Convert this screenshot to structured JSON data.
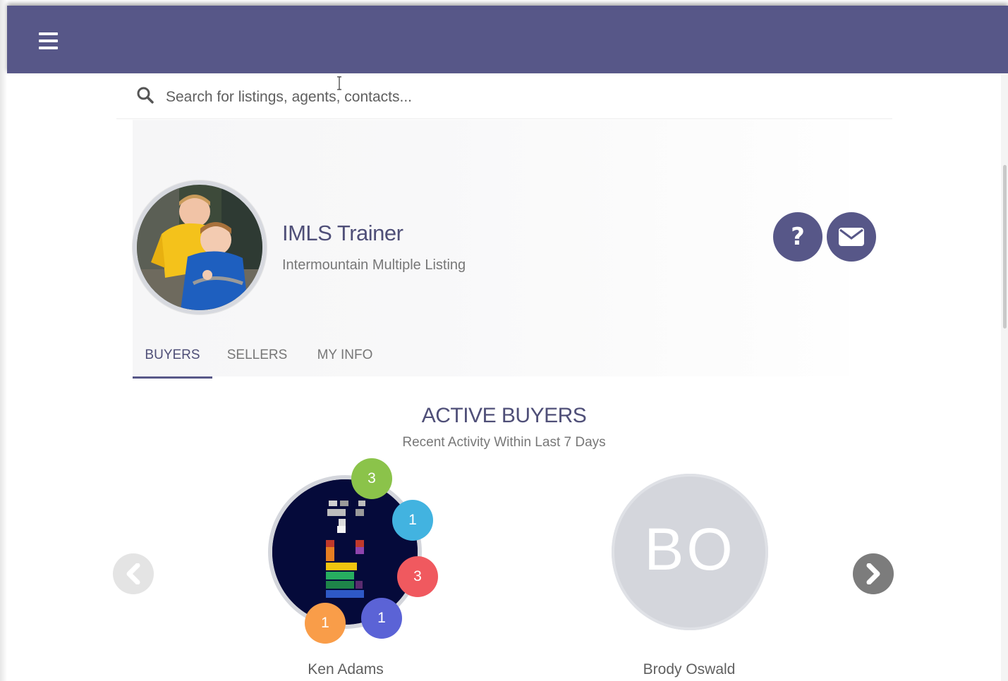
{
  "header": {
    "menu_icon": "hamburger-icon",
    "bg_color": "#575788"
  },
  "search": {
    "placeholder": "Search for listings, agents, contacts...",
    "icon": "search-icon"
  },
  "profile": {
    "name": "IMLS Trainer",
    "organization": "Intermountain Multiple Listing",
    "help_label": "?",
    "mail_icon": "envelope-icon"
  },
  "tabs": [
    {
      "label": "BUYERS",
      "active": true
    },
    {
      "label": "SELLERS",
      "active": false
    },
    {
      "label": "MY INFO",
      "active": false
    }
  ],
  "section": {
    "title": "ACTIVE BUYERS",
    "subtitle": "Recent Activity Within Last 7 Days"
  },
  "buyers": [
    {
      "name": "Ken Adams",
      "badges": [
        {
          "count": "3",
          "color": "#8bc34a"
        },
        {
          "count": "1",
          "color": "#42b3e0"
        },
        {
          "count": "3",
          "color": "#f0595f"
        },
        {
          "count": "1",
          "color": "#5b63d6"
        },
        {
          "count": "1",
          "color": "#f99d49"
        }
      ]
    },
    {
      "name": "Brody Oswald",
      "initials": "BO"
    }
  ],
  "carousel": {
    "prev_icon": "chevron-left-icon",
    "next_icon": "chevron-right-icon"
  }
}
